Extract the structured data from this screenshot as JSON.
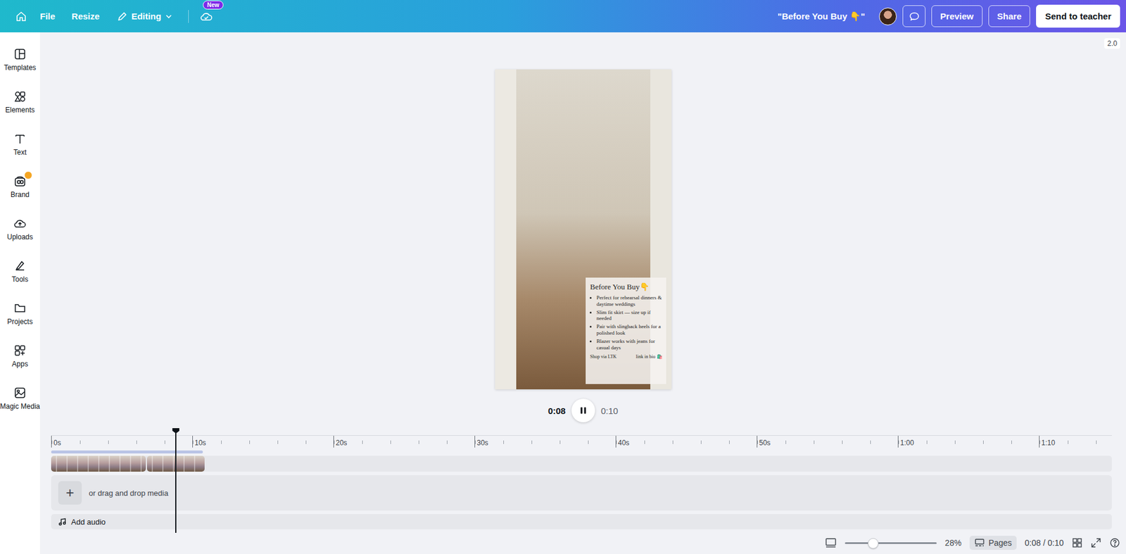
{
  "topbar": {
    "menus": [
      "File",
      "Resize"
    ],
    "mode": "Editing",
    "new_badge": "New",
    "title": "\"Before You Buy 👇\"",
    "buttons": [
      "Preview",
      "Share"
    ],
    "primary_button": "Send to teacher"
  },
  "version_badge": "2.0",
  "sidebar": {
    "items": [
      {
        "label": "Templates",
        "badge": false
      },
      {
        "label": "Elements",
        "badge": false
      },
      {
        "label": "Text",
        "badge": false
      },
      {
        "label": "Brand",
        "badge": true
      },
      {
        "label": "Uploads",
        "badge": false
      },
      {
        "label": "Tools",
        "badge": false
      },
      {
        "label": "Projects",
        "badge": false
      },
      {
        "label": "Apps",
        "badge": false
      },
      {
        "label": "Magic Media",
        "badge": false
      }
    ]
  },
  "video": {
    "overlay": {
      "heading": "Before You Buy👇",
      "bullets": [
        "Perfect for rehearsal dinners & daytime weddings",
        "Slim fit skirt — size up if needed",
        "Pair with slingback heels for a polished look",
        "Blazer works with jeans for casual days"
      ],
      "footer_left": "Shop via LTK",
      "footer_right": "link in bio 🛍️"
    }
  },
  "player": {
    "current": "0:08",
    "total": "0:10",
    "playing": true
  },
  "timeline": {
    "ticks": [
      "0s",
      "10s",
      "20s",
      "30s",
      "40s",
      "50s",
      "1:00",
      "1:10"
    ],
    "clips": [
      {
        "duration": 6.7
      },
      {
        "duration": 4.1
      }
    ],
    "playhead_seconds": 8.8,
    "media_track": {
      "icon": "+",
      "label": "or drag and drop media"
    },
    "audio_track": {
      "label": "Add audio"
    }
  },
  "bottombar": {
    "zoom_level": 0.3,
    "zoom": "28%",
    "pages": {
      "label": "Pages",
      "selected": true
    },
    "time": "0:08 / 0:10"
  }
}
